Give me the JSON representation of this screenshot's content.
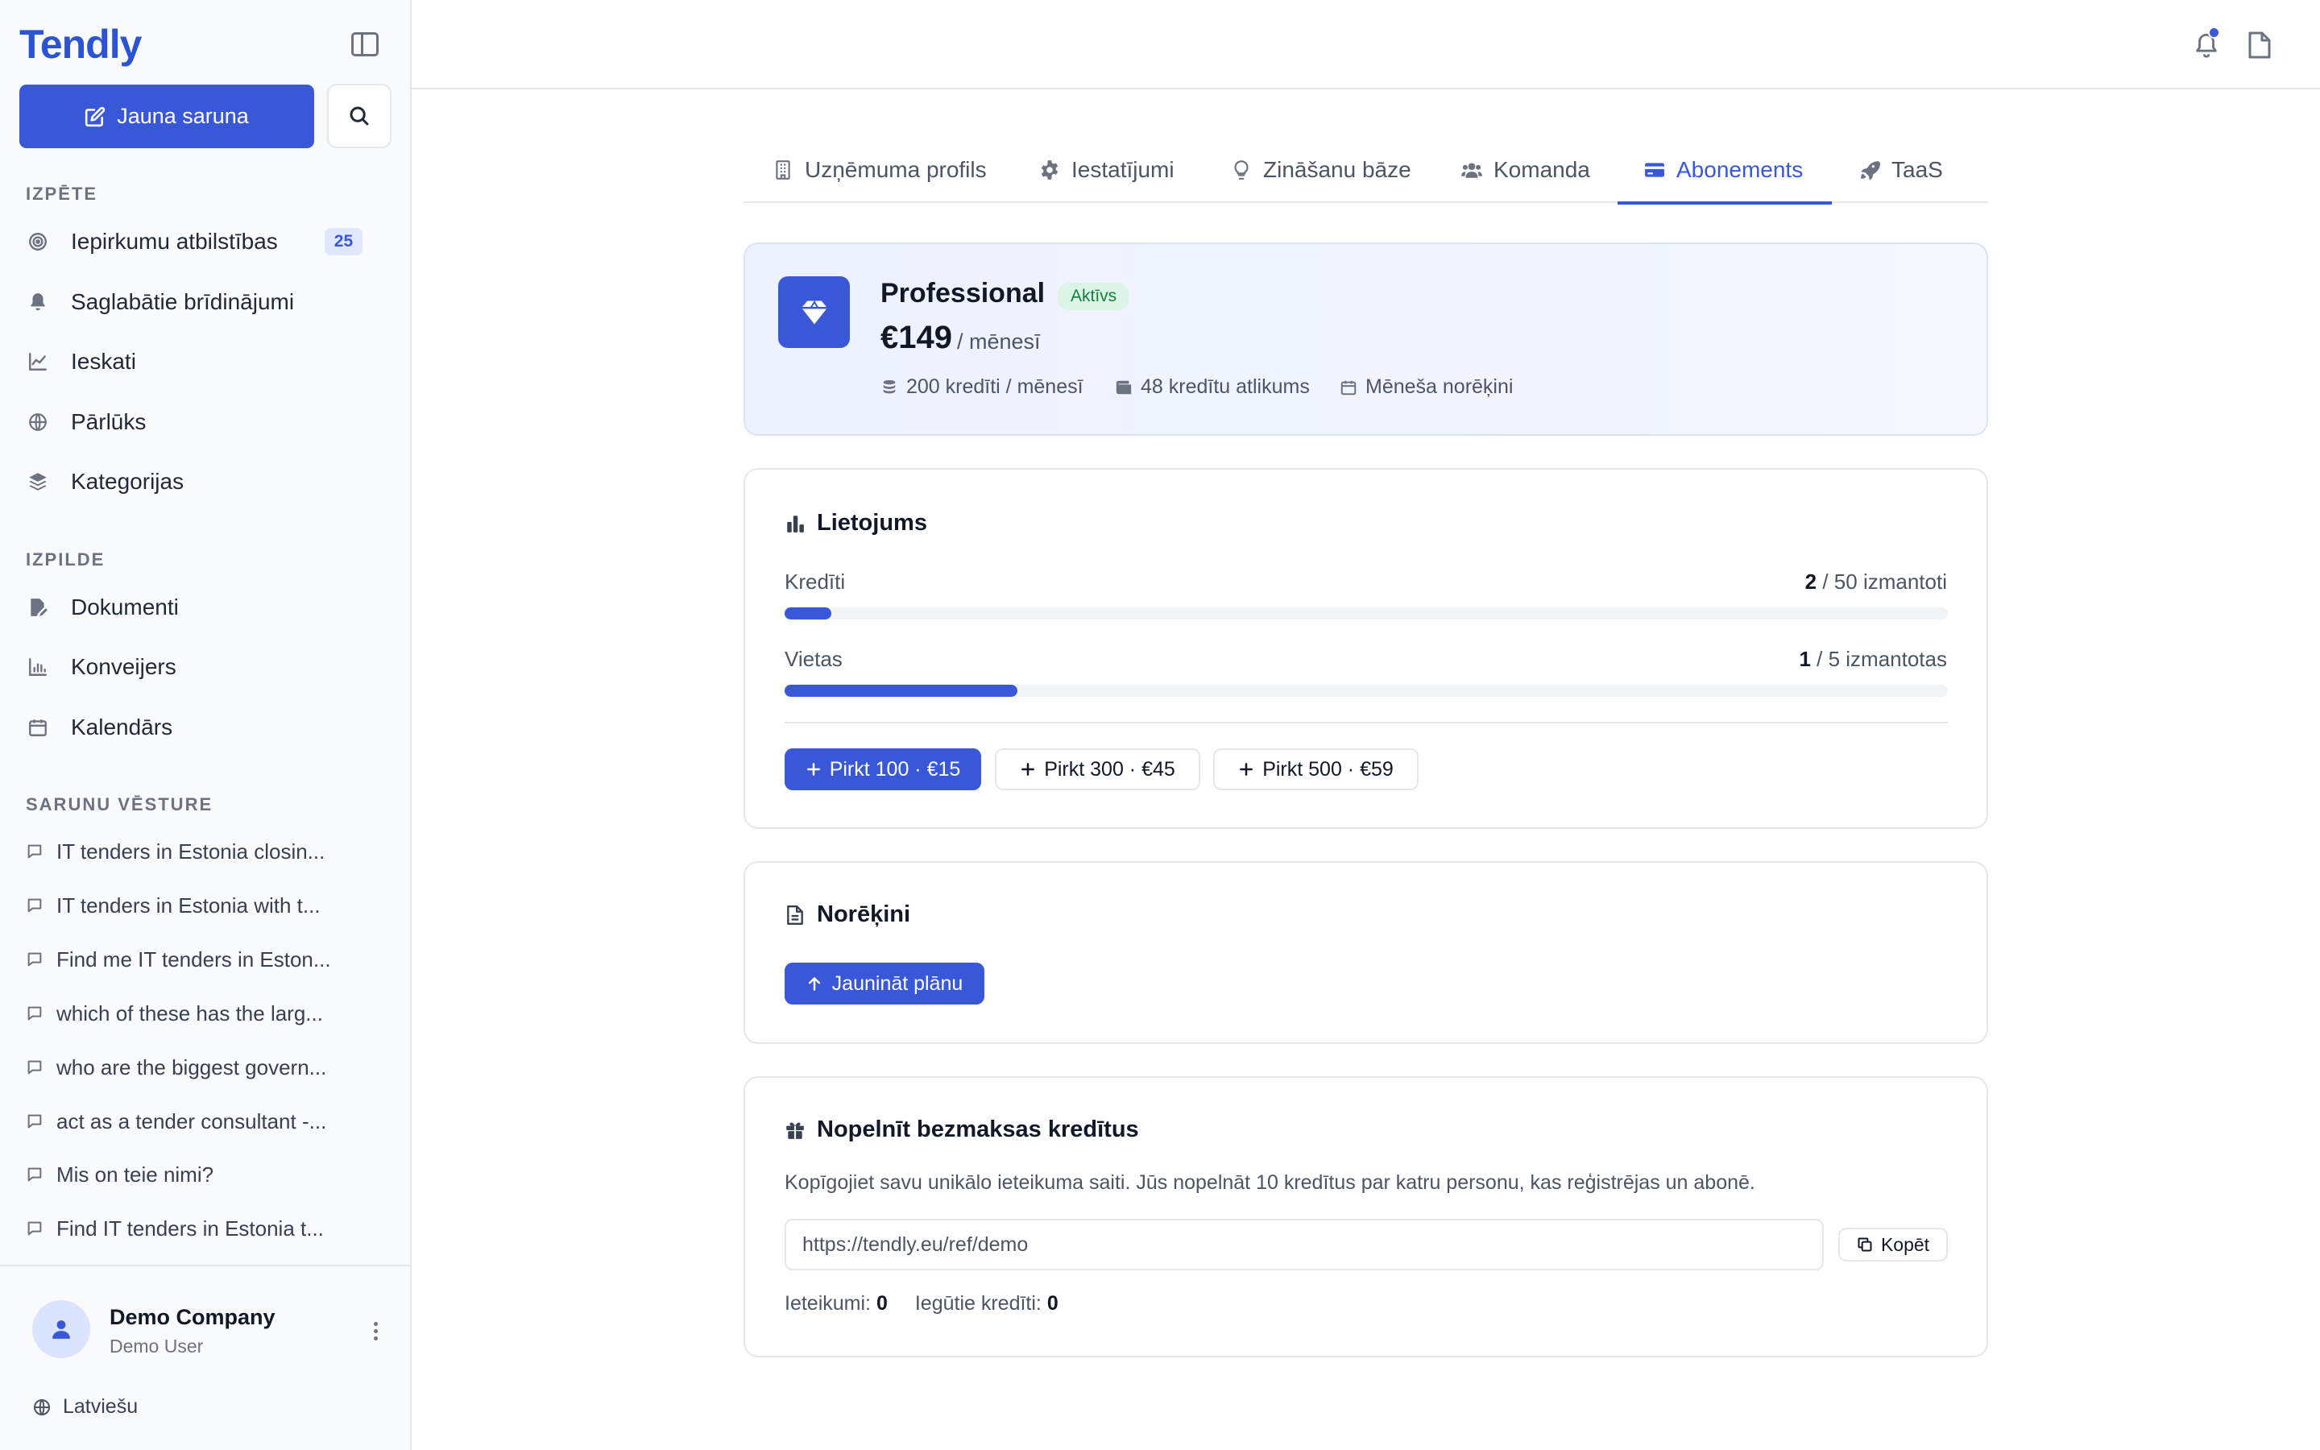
{
  "sidebar": {
    "logo": "Tendly",
    "new_chat_label": "Jauna saruna",
    "sections": {
      "explore": "IZPĒTE",
      "execution": "IZPILDE",
      "history": "SARUNU VĒSTURE"
    },
    "explore_items": [
      {
        "label": "Iepirkumu atbilstības",
        "icon": "target-icon",
        "badge": "25"
      },
      {
        "label": "Saglabātie brīdinājumi",
        "icon": "bell-icon"
      },
      {
        "label": "Ieskati",
        "icon": "chart-line-icon"
      },
      {
        "label": "Pārlūks",
        "icon": "globe-icon"
      },
      {
        "label": "Kategorijas",
        "icon": "layers-icon"
      }
    ],
    "execution_items": [
      {
        "label": "Dokumenti",
        "icon": "document-edit-icon"
      },
      {
        "label": "Konveijers",
        "icon": "bar-chart-icon"
      },
      {
        "label": "Kalendārs",
        "icon": "calendar-icon"
      }
    ],
    "history": [
      "IT tenders in Estonia closin...",
      "IT tenders in Estonia with t...",
      "Find me IT tenders in Eston...",
      "which of these has the larg...",
      "who are the biggest govern...",
      "act as a tender consultant -...",
      "Mis on teie nimi?",
      "Find IT tenders in Estonia t..."
    ],
    "footer": {
      "company": "Demo Company",
      "user": "Demo User",
      "language": "Latviešu"
    }
  },
  "tabs": [
    {
      "label": "Uzņēmuma profils",
      "icon": "building-icon"
    },
    {
      "label": "Iestatījumi",
      "icon": "gear-icon"
    },
    {
      "label": "Zināšanu bāze",
      "icon": "lightbulb-icon"
    },
    {
      "label": "Komanda",
      "icon": "users-icon"
    },
    {
      "label": "Abonements",
      "icon": "credit-card-icon",
      "active": true
    },
    {
      "label": "TaaS",
      "icon": "rocket-icon"
    }
  ],
  "plan": {
    "name": "Professional",
    "status": "Aktīvs",
    "price": "€149",
    "period": "/ mēnesī",
    "meta": [
      "200 kredīti / mēnesī",
      "48 kredītu atlikums",
      "Mēneša norēķini"
    ]
  },
  "usage": {
    "title": "Lietojums",
    "credits": {
      "label": "Kredīti",
      "used": "2",
      "rest": "/ 50 izmantoti",
      "fraction": 0.04
    },
    "seats": {
      "label": "Vietas",
      "used": "1",
      "rest": "/ 5 izmantotas",
      "fraction": 0.2
    },
    "buy": [
      "Pirkt 100 · €15",
      "Pirkt 300 · €45",
      "Pirkt 500 · €59"
    ]
  },
  "billing": {
    "title": "Norēķini",
    "upgrade_label": "Jaunināt plānu"
  },
  "referral": {
    "title": "Nopelnīt bezmaksas kredītus",
    "description": "Kopīgojiet savu unikālo ieteikuma saiti. Jūs nopelnāt 10 kredītus par katru personu, kas reģistrējas un abonē.",
    "link": "https://tendly.eu/ref/demo",
    "copy_label": "Kopēt",
    "referrals_label": "Ieteikumi:",
    "referrals_value": "0",
    "credits_label": "Iegūtie kredīti:",
    "credits_value": "0"
  },
  "colors": {
    "accent": "#3858d8",
    "status_green_bg": "#dcf5e7",
    "status_green_text": "#15803d"
  }
}
